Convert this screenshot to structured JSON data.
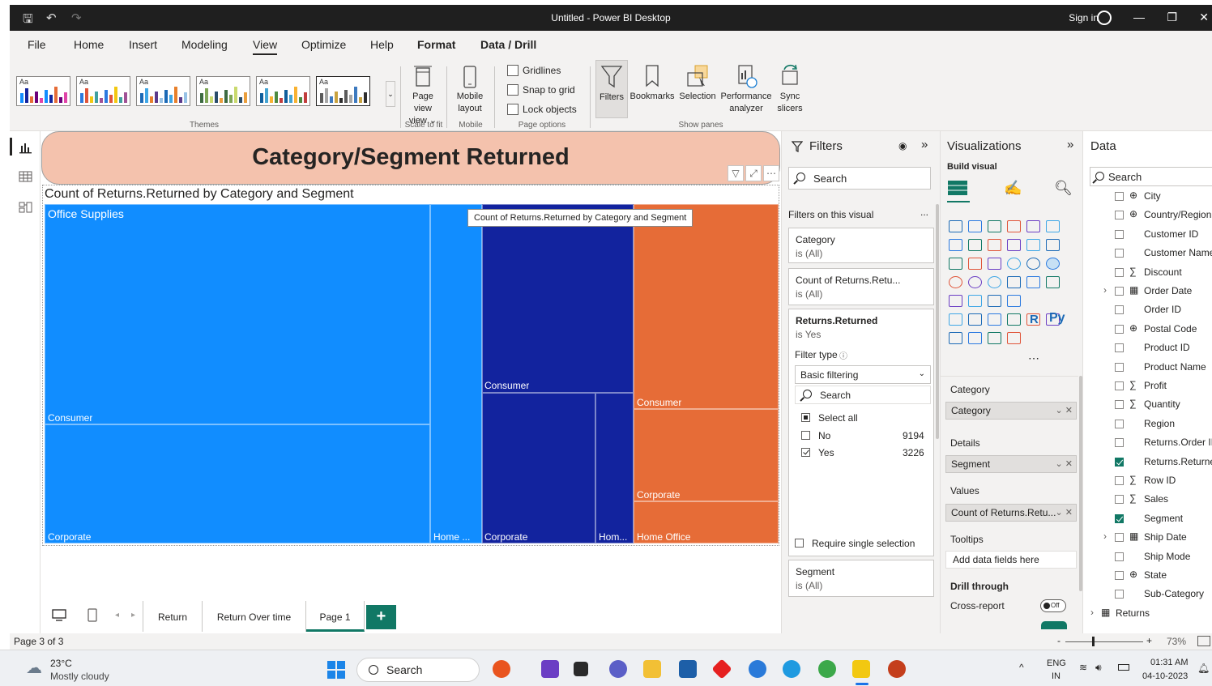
{
  "window": {
    "title": "Untitled - Power BI Desktop",
    "sign_in": "Sign in"
  },
  "menu": {
    "tabs": [
      "File",
      "Home",
      "Insert",
      "Modeling",
      "View",
      "Optimize",
      "Help",
      "Format",
      "Data / Drill"
    ],
    "active": "View"
  },
  "ribbon": {
    "theme_tile_label": "Aa",
    "groups": {
      "themes": "Themes",
      "scale": "Scale to fit",
      "mobile": "Mobile",
      "page_options": "Page options",
      "show_panes": "Show panes"
    },
    "page_view": "Page view",
    "page_view_2": "view",
    "mobile_layout": "Mobile",
    "mobile_layout_2": "layout",
    "gridlines": "Gridlines",
    "snap": "Snap to grid",
    "lock": "Lock objects",
    "filters": "Filters",
    "bookmarks": "Bookmarks",
    "selection": "Selection",
    "performance": "Performance",
    "performance_2": "analyzer",
    "sync": "Sync",
    "sync_2": "slicers"
  },
  "report": {
    "banner_title": "Category/Segment Returned",
    "visual_title": "Count of Returns.Returned by Category and Segment",
    "tooltip": "Count of Returns.Returned by Category and Segment",
    "treemap": {
      "cat_office": "Office Supplies",
      "os_consumer": "Consumer",
      "os_corporate": "Corporate",
      "os_home": "Home ...",
      "tech_consumer": "Consumer",
      "tech_corporate": "Corporate",
      "tech_home": "Hom...",
      "furn_consumer": "Consumer",
      "furn_corporate": "Corporate",
      "furn_home": "Home Office"
    },
    "colors": {
      "office_supplies": "#118dff",
      "technology": "#12239e",
      "furniture": "#e66c37"
    }
  },
  "page_tabs": [
    "Return",
    "Return Over time",
    "Page 1"
  ],
  "page_tab_active": "Page 1",
  "status": {
    "page": "Page 3 of 3",
    "zoom": "73%",
    "zoom_plus": "+",
    "zoom_minus": "-"
  },
  "filters_pane": {
    "title": "Filters",
    "search": "Search",
    "section": "Filters on this visual",
    "more": "...",
    "cards": [
      {
        "title": "Category",
        "sub": "is (All)"
      },
      {
        "title": "Count of Returns.Retu...",
        "sub": "is (All)"
      }
    ],
    "active_card": {
      "title": "Returns.Returned",
      "sub": "is Yes",
      "filter_type": "Filter type",
      "mode": "Basic filtering",
      "search": "Search",
      "select_all": "Select all",
      "options": [
        {
          "label": "No",
          "count": "9194"
        },
        {
          "label": "Yes",
          "count": "3226"
        }
      ],
      "require_single": "Require single selection"
    },
    "segment_card": {
      "title": "Segment",
      "sub": "is (All)"
    }
  },
  "viz_pane": {
    "title": "Visualizations",
    "build": "Build visual",
    "wells": {
      "category_label": "Category",
      "category_value": "Category",
      "details_label": "Details",
      "details_value": "Segment",
      "values_label": "Values",
      "values_value": "Count of Returns.Retu...",
      "tooltips_label": "Tooltips",
      "tooltips_hint": "Add data fields here",
      "drill": "Drill through",
      "cross_report": "Cross-report",
      "toggle": "Off"
    },
    "r_label": "R",
    "py_label": "Py"
  },
  "data_pane": {
    "title": "Data",
    "search": "Search",
    "fields": [
      {
        "name": "City",
        "icon": "globe-icon",
        "checked": false
      },
      {
        "name": "Country/Region",
        "icon": "globe-icon",
        "checked": false
      },
      {
        "name": "Customer ID",
        "icon": "",
        "checked": false
      },
      {
        "name": "Customer Name",
        "icon": "",
        "checked": false
      },
      {
        "name": "Discount",
        "icon": "sigma-icon",
        "checked": false
      },
      {
        "name": "Order Date",
        "icon": "calendar-icon",
        "checked": false,
        "expandable": true
      },
      {
        "name": "Order ID",
        "icon": "",
        "checked": false
      },
      {
        "name": "Postal Code",
        "icon": "globe-icon",
        "checked": false
      },
      {
        "name": "Product ID",
        "icon": "",
        "checked": false
      },
      {
        "name": "Product Name",
        "icon": "",
        "checked": false
      },
      {
        "name": "Profit",
        "icon": "sigma-icon",
        "checked": false
      },
      {
        "name": "Quantity",
        "icon": "sigma-icon",
        "checked": false
      },
      {
        "name": "Region",
        "icon": "",
        "checked": false
      },
      {
        "name": "Returns.Order ID",
        "icon": "",
        "checked": false
      },
      {
        "name": "Returns.Returned",
        "icon": "",
        "checked": true
      },
      {
        "name": "Row ID",
        "icon": "sigma-icon",
        "checked": false
      },
      {
        "name": "Sales",
        "icon": "sigma-icon",
        "checked": false
      },
      {
        "name": "Segment",
        "icon": "",
        "checked": true
      },
      {
        "name": "Ship Date",
        "icon": "calendar-icon",
        "checked": false,
        "expandable": true
      },
      {
        "name": "Ship Mode",
        "icon": "",
        "checked": false
      },
      {
        "name": "State",
        "icon": "globe-icon",
        "checked": false
      },
      {
        "name": "Sub-Category",
        "icon": "",
        "checked": false
      }
    ],
    "table": "Returns"
  },
  "taskbar": {
    "weather_temp": "23°C",
    "weather_desc": "Mostly cloudy",
    "search": "Search",
    "lang": "ENG",
    "region": "IN",
    "time": "01:31 AM",
    "date": "04-10-2023"
  }
}
